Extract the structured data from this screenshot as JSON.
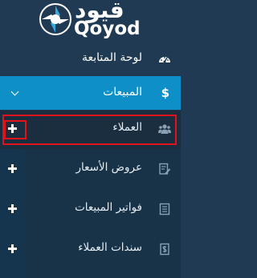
{
  "logo": {
    "text_ar": "قيود",
    "text_en": "Qoyod"
  },
  "sidebar": {
    "dashboard": {
      "label": "لوحة المتابعة",
      "icon": "dashboard-gauge-icon"
    },
    "sales": {
      "label": "المبيعات",
      "icon": "dollar-icon",
      "expanded": true,
      "icon_glyph": "$"
    },
    "sales_items": [
      {
        "label": "العملاء",
        "icon": "users-icon",
        "active": true
      },
      {
        "label": "عروض الأسعار",
        "icon": "quote-edit-icon"
      },
      {
        "label": "فواتير المبيعات",
        "icon": "invoice-list-icon"
      },
      {
        "label": "سندات العملاء",
        "icon": "receipt-icon"
      }
    ]
  },
  "colors": {
    "sidebar_bg": "#1f3a52",
    "active_section_bg": "#0f8fc7",
    "submenu_bg": "#183248",
    "highlight": "#e0131b"
  }
}
